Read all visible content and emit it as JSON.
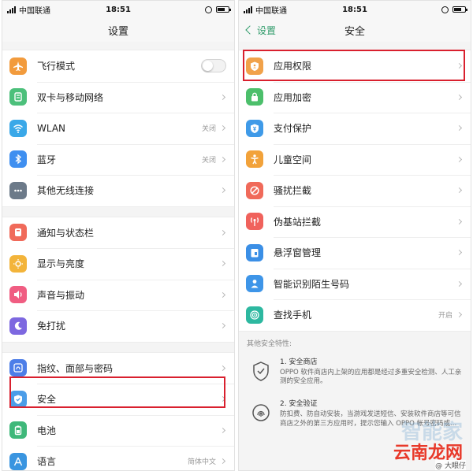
{
  "colors": {
    "highlight": "#d9202e",
    "accent": "#2f9b6a"
  },
  "left": {
    "status": {
      "carrier": "中国联通",
      "time": "18:51"
    },
    "title": "设置",
    "groups": [
      [
        {
          "icon": "airplane-icon",
          "label": "飞行模式",
          "toggle": true,
          "color": "#f29b3d"
        },
        {
          "icon": "dual-sim-icon",
          "label": "双卡与移动网络",
          "color": "#4cc07b"
        },
        {
          "icon": "wifi-icon",
          "label": "WLAN",
          "value": "关闭",
          "color": "#3aa8e8"
        },
        {
          "icon": "bluetooth-icon",
          "label": "蓝牙",
          "value": "关闭",
          "color": "#3f8ff0"
        },
        {
          "icon": "more-icon",
          "label": "其他无线连接",
          "color": "#6c7a89"
        }
      ],
      [
        {
          "icon": "notification-icon",
          "label": "通知与状态栏",
          "color": "#f06a5a"
        },
        {
          "icon": "brightness-icon",
          "label": "显示与亮度",
          "color": "#f3b43a"
        },
        {
          "icon": "sound-icon",
          "label": "声音与振动",
          "color": "#f05d82"
        },
        {
          "icon": "moon-icon",
          "label": "免打扰",
          "color": "#7d68e0"
        }
      ],
      [
        {
          "icon": "fingerprint-icon",
          "label": "指纹、面部与密码",
          "color": "#4d7ee8"
        },
        {
          "icon": "shield-icon",
          "label": "安全",
          "color": "#4b9de8"
        },
        {
          "icon": "battery-icon",
          "label": "电池",
          "color": "#3fb87a"
        },
        {
          "icon": "language-icon",
          "label": "语言",
          "value": "简体中文",
          "color": "#3a95e0"
        }
      ]
    ]
  },
  "right": {
    "status": {
      "carrier": "中国联通",
      "time": "18:51"
    },
    "back": "设置",
    "title": "安全",
    "items": [
      {
        "icon": "app-permission-icon",
        "label": "应用权限",
        "color": "#f1a24a"
      },
      {
        "icon": "lock-icon",
        "label": "应用加密",
        "color": "#4cbf6b"
      },
      {
        "icon": "payment-shield-icon",
        "label": "支付保护",
        "color": "#3f9ae8"
      },
      {
        "icon": "child-icon",
        "label": "儿童空间",
        "color": "#f2a23a"
      },
      {
        "icon": "block-icon",
        "label": "骚扰拦截",
        "color": "#f06a5a"
      },
      {
        "icon": "fake-station-icon",
        "label": "伪基站拦截",
        "color": "#f0625c"
      },
      {
        "icon": "floating-window-icon",
        "label": "悬浮窗管理",
        "color": "#3b8fe6"
      },
      {
        "icon": "caller-id-icon",
        "label": "智能识别陌生号码",
        "color": "#3e95e8"
      },
      {
        "icon": "find-phone-icon",
        "label": "查找手机",
        "value": "开启",
        "color": "#2db8a0"
      }
    ],
    "features_title": "其他安全特性:",
    "features": [
      {
        "icon": "store-shield-icon",
        "title": "1. 安全商店",
        "desc": "OPPO 软件商店内上架的应用都是经过多重安全检测、人工亲测的安全应用。"
      },
      {
        "icon": "install-fingerprint-icon",
        "title": "2. 安全验证",
        "desc": "防扣费、防自动安装，当游戏发送短信、安装软件商店等可信商店之外的第三方应用时，提示您输入 OPPO 帐号密码或..."
      }
    ]
  },
  "watermark": {
    "brand": "云南龙网",
    "ghost": "智能家",
    "weibo": "@ 大眼仔"
  }
}
